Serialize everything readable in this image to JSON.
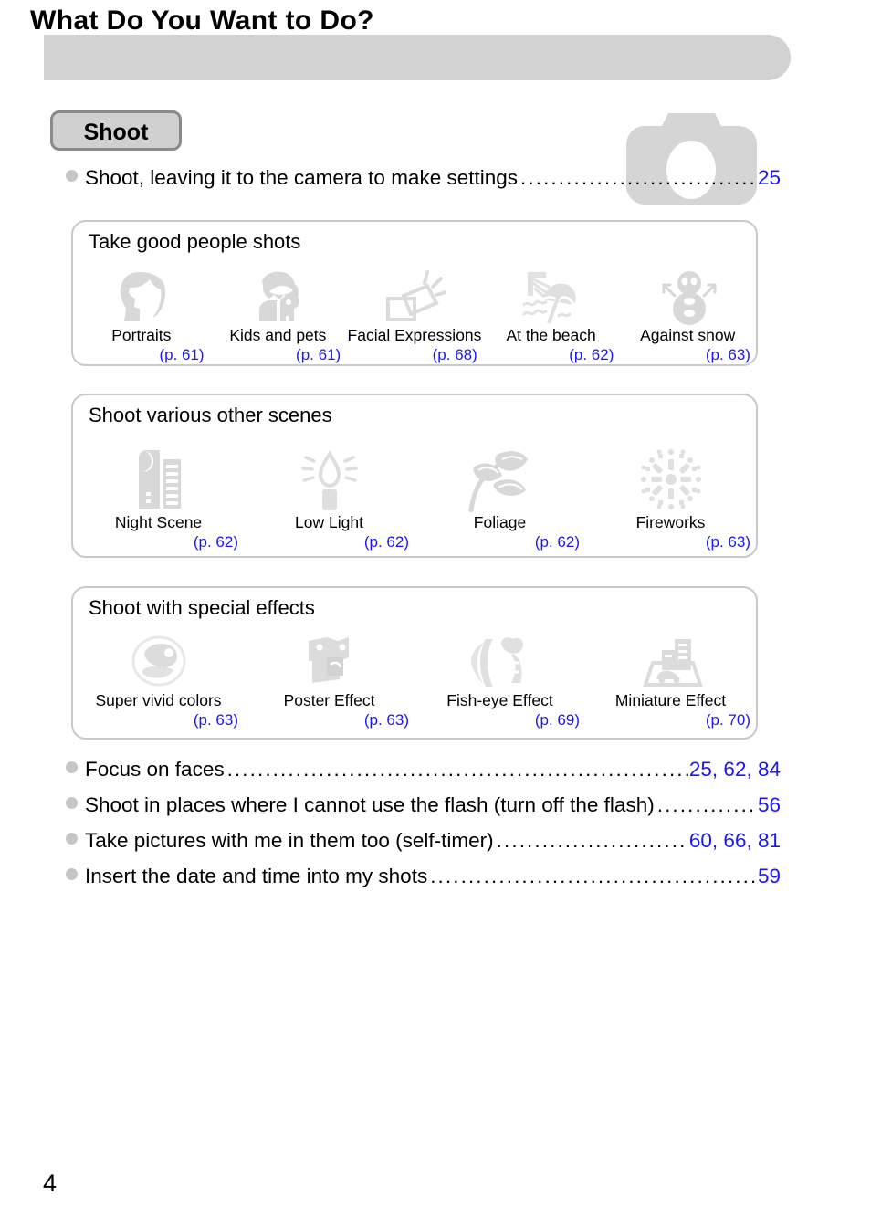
{
  "header": {
    "title": "What Do You Want to Do?"
  },
  "section": {
    "tab_label": "Shoot",
    "camera_icon": "camera-icon"
  },
  "top_entry": {
    "bullet": "bullet-dot",
    "text": "Shoot, leaving it to the camera to make settings",
    "leader": "..........................................................................",
    "pages": "25"
  },
  "boxes": [
    {
      "title": "Take good people shots",
      "items": [
        {
          "icon": "portrait-face-icon",
          "label": "Portraits",
          "page": "(p. 61)"
        },
        {
          "icon": "kids-and-pets-icon",
          "label": "Kids and pets",
          "page": "(p. 61)"
        },
        {
          "icon": "facial-expressions-icon",
          "label": "Facial Expressions",
          "page": "(p. 68)"
        },
        {
          "icon": "beach-umbrella-icon",
          "label": "At the beach",
          "page": "(p. 62)"
        },
        {
          "icon": "snowman-icon",
          "label": "Against snow",
          "page": "(p. 63)"
        }
      ]
    },
    {
      "title": "Shoot various other scenes",
      "items": [
        {
          "icon": "night-scene-icon",
          "label": "Night Scene",
          "page": "(p. 62)"
        },
        {
          "icon": "candle-icon",
          "label": "Low Light",
          "page": "(p. 62)"
        },
        {
          "icon": "foliage-icon",
          "label": "Foliage",
          "page": "(p. 62)"
        },
        {
          "icon": "fireworks-icon",
          "label": "Fireworks",
          "page": "(p. 63)"
        }
      ]
    },
    {
      "title": "Shoot with special effects",
      "items": [
        {
          "icon": "super-vivid-icon",
          "label": "Super vivid colors",
          "page": "(p. 63)"
        },
        {
          "icon": "poster-effect-icon",
          "label": "Poster Effect",
          "page": "(p. 63)"
        },
        {
          "icon": "fish-eye-icon",
          "label": "Fish-eye Effect",
          "page": "(p. 69)"
        },
        {
          "icon": "miniature-effect-icon",
          "label": "Miniature Effect",
          "page": "(p. 70)"
        }
      ]
    }
  ],
  "bottom_entries": [
    {
      "text": "Focus on faces",
      "leader": "...........................................................",
      "pages": "25, 62, 84"
    },
    {
      "text": "Shoot in places where I cannot use the flash (turn off the flash)",
      "leader": "....",
      "pages": "56"
    },
    {
      "text": "Take pictures with me in them too (self-timer)",
      "leader": ".................",
      "pages": "60, 66, 81"
    },
    {
      "text": "Insert the date and time into my shots",
      "leader": "........................................",
      "pages": "59"
    }
  ],
  "folio": "4",
  "colors": {
    "header_bg": "#d2d2d2",
    "tab_bg": "#d0d0d0",
    "tab_border": "#8a8a8a",
    "box_border": "#c9c9c9",
    "icon_gray": "#d8d8d8",
    "link_blue": "#1b18f0",
    "bullet_gray": "#c6c6c6"
  }
}
